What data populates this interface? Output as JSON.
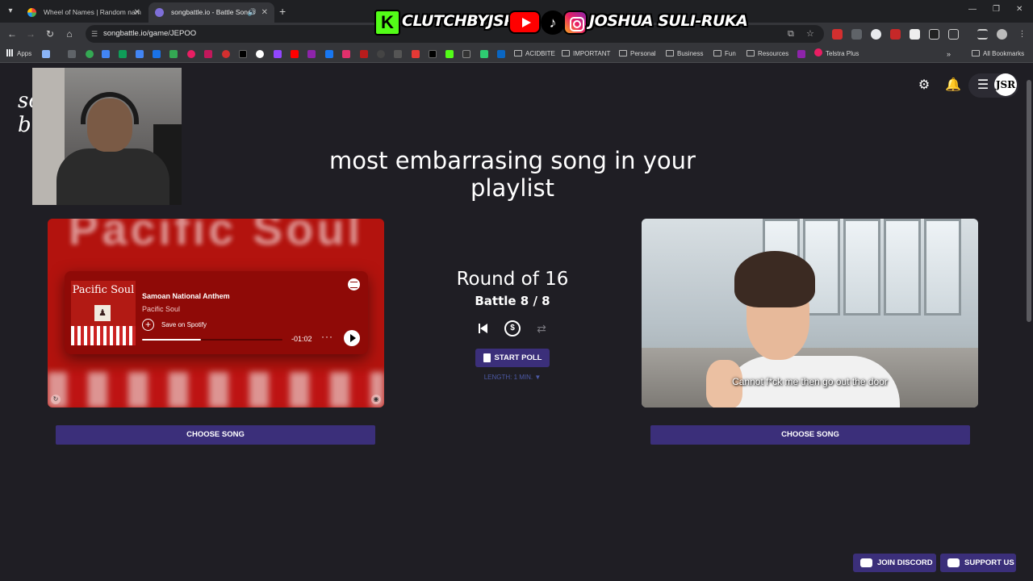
{
  "browser": {
    "tabs": [
      {
        "title": "Wheel of Names | Random nam",
        "active": false,
        "favicon_color": "#4caf50"
      },
      {
        "title": "songbattle.io - Battle Songs",
        "active": true,
        "favicon_color": "#7e6fd8"
      }
    ],
    "url": "songbattle.io/game/JEPOO",
    "bookmarks": {
      "apps_label": "Apps",
      "items": [
        "ACIDBITE",
        "IMPORTANT",
        "Personal",
        "Business",
        "Fun",
        "Resources",
        "Telstra Plus"
      ],
      "all_bookmarks": "All Bookmarks"
    }
  },
  "overlay": {
    "kick_handle": "CLUTCHBYJSR",
    "social_handle": "JOSHUA SULI-RUKA"
  },
  "app": {
    "logo_fragment": "so\nb",
    "avatar_text": "JSR",
    "prompt": "most embarrasing song in your playlist"
  },
  "left_card": {
    "album_title": "Pacific Soul",
    "song": "Samoan National Anthem",
    "artist": "Pacific Soul",
    "save_label": "Save on Spotify",
    "time_remaining": "-01:02",
    "progress": 0.42,
    "choose_label": "CHOOSE SONG"
  },
  "center": {
    "round": "Round of 16",
    "battle": "Battle 8 / 8",
    "poll_label": "START POLL",
    "length_label": "LENGTH: 1 MIN. ▼"
  },
  "right_card": {
    "subtitle": "Cannot f*ck me then go out the door",
    "choose_label": "CHOOSE SONG"
  },
  "footer": {
    "discord_label": "JOIN DISCORD",
    "support_label": "SUPPORT US"
  }
}
